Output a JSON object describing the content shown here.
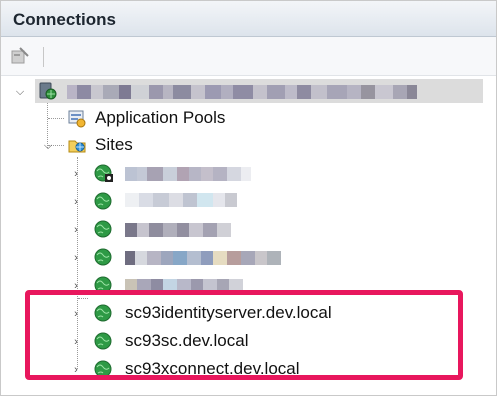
{
  "header": {
    "title": "Connections"
  },
  "tree": {
    "root": {
      "label": "WIN-3T8F6CBTL (AVANADE-CORP\\...)",
      "expanded": true
    },
    "app_pools": {
      "label": "Application Pools"
    },
    "sites": {
      "label": "Sites",
      "expanded": true,
      "items": [
        {
          "label": ""
        },
        {
          "label": ""
        },
        {
          "label": ""
        },
        {
          "label": ""
        },
        {
          "label": ""
        },
        {
          "label": "sc93identityserver.dev.local"
        },
        {
          "label": "sc93sc.dev.local"
        },
        {
          "label": "sc93xconnect.dev.local"
        }
      ]
    }
  },
  "colors": {
    "highlight": "#e8175d",
    "selected": "#dcdcdc"
  }
}
